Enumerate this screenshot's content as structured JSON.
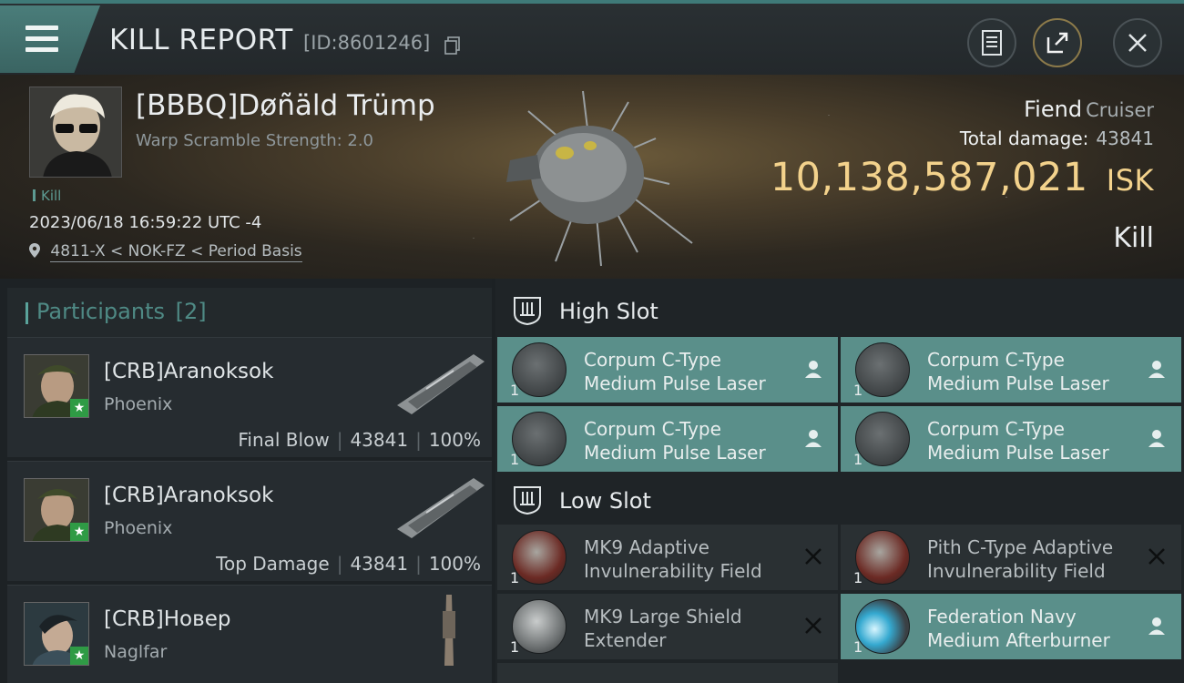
{
  "header": {
    "title": "KILL REPORT",
    "id_text": "[ID:8601246]"
  },
  "victim": {
    "name": "[BBBQ]Døñäld Trümp",
    "warp_scramble": "Warp Scramble Strength: 2.0",
    "tag": "Kill",
    "datetime": "2023/06/18 16:59:22 UTC -4",
    "location": "4811-X < NOK-FZ < Period Basis",
    "ship_name": "Fiend",
    "ship_class": "Cruiser",
    "total_damage_label": "Total damage:",
    "total_damage": "43841",
    "isk_value": "10,138,587,021",
    "isk_unit": "ISK",
    "outcome": "Kill"
  },
  "participants": {
    "label": "Participants",
    "count": "[2]",
    "rows": [
      {
        "name": "[CRB]Aranoksok",
        "ship": "Phoenix",
        "role": "Final Blow",
        "damage": "43841",
        "percent": "100%"
      },
      {
        "name": "[CRB]Aranoksok",
        "ship": "Phoenix",
        "role": "Top Damage",
        "damage": "43841",
        "percent": "100%"
      },
      {
        "name": "[CRB]Новер",
        "ship": "Naglfar"
      }
    ],
    "badge_icon": "star-icon"
  },
  "fitting": {
    "high_slot_label": "High Slot",
    "low_slot_label": "Low Slot",
    "high": [
      {
        "qty": "1",
        "line1": "Corpum C-Type",
        "line2": "Medium Pulse Laser",
        "state": "dropped"
      },
      {
        "qty": "1",
        "line1": "Corpum C-Type",
        "line2": "Medium Pulse Laser",
        "state": "dropped"
      },
      {
        "qty": "1",
        "line1": "Corpum C-Type",
        "line2": "Medium Pulse Laser",
        "state": "dropped"
      },
      {
        "qty": "1",
        "line1": "Corpum C-Type",
        "line2": "Medium Pulse Laser",
        "state": "dropped"
      }
    ],
    "low": [
      {
        "qty": "1",
        "line1": "MK9 Adaptive",
        "line2": "Invulnerability Field",
        "state": "destroyed"
      },
      {
        "qty": "1",
        "line1": "Pith C-Type Adaptive",
        "line2": "Invulnerability Field",
        "state": "destroyed"
      },
      {
        "qty": "1",
        "line1": "MK9 Large Shield",
        "line2": "Extender",
        "state": "destroyed"
      },
      {
        "qty": "1",
        "line1": "Federation Navy",
        "line2": "Medium Afterburner",
        "state": "dropped"
      }
    ]
  },
  "colors": {
    "accent": "#5a8f8a",
    "isk": "#f3d28c",
    "badge": "#2f9b45"
  }
}
